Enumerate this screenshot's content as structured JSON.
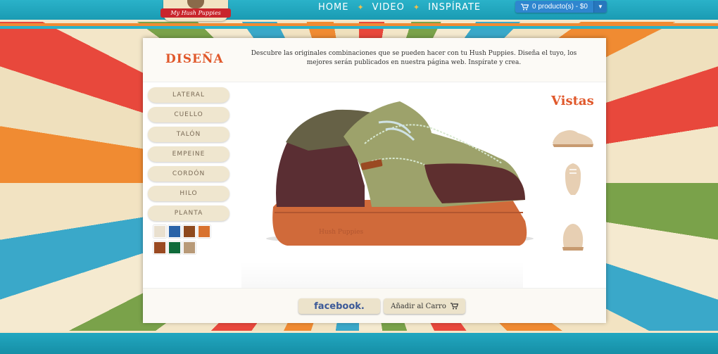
{
  "header": {
    "logo_text": "My Hush Puppies",
    "nav": [
      "HOME",
      "VIDEO",
      "INSPÍRATE"
    ],
    "cart_label": "0 producto(s) - $0"
  },
  "panel": {
    "title": "DISEÑA",
    "description": "Descubre las originales combinaciones que se pueden hacer con tu Hush Puppies. Diseña el tuyo, los mejores serán publicados en nuestra página web. Inspírate y crea.",
    "menu": [
      "LATERAL",
      "CUELLO",
      "TALÓN",
      "EMPEINE",
      "CORDÓN",
      "HILO",
      "PLANTA"
    ],
    "swatch_colors": [
      "#e9e0cf",
      "#2a63a8",
      "#8f4a1e",
      "#d8722f",
      "#9a4a22",
      "#0f6a3a",
      "#b89a78"
    ],
    "views_title": "Vistas",
    "shoe_brand": "Hush Puppies",
    "facebook_label": "facebook.",
    "add_to_cart_label": "Añadir al Carro"
  },
  "icons": {
    "cart": "cart-icon",
    "caret": "caret-down-icon"
  }
}
